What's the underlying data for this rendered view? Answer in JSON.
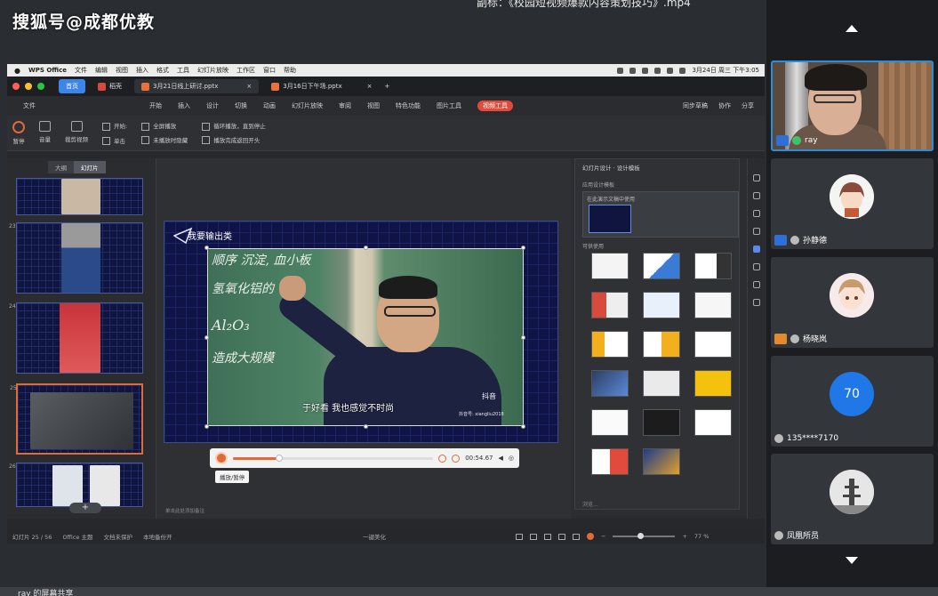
{
  "watermark": "搜狐号@成都优教",
  "window_title": "副标：《校园短视频爆款内容策划技巧》.mp4",
  "mac_menubar": {
    "app": "WPS Office",
    "items": [
      "文件",
      "编辑",
      "视图",
      "插入",
      "格式",
      "工具",
      "幻灯片放映",
      "工作区",
      "窗口",
      "帮助"
    ],
    "clock": "3月24日 周三 下午3:05"
  },
  "tabs": [
    {
      "label": "首页"
    },
    {
      "label": "稻壳"
    },
    {
      "label": "3月21日线上研讨.pptx"
    },
    {
      "label": "3月16日下午场.pptx"
    }
  ],
  "ribbon_tabs": [
    "文件",
    "开始",
    "插入",
    "设计",
    "切换",
    "动画",
    "幻灯片放映",
    "审阅",
    "视图",
    "特色功能",
    "图片工具",
    "视频工具"
  ],
  "ribbon_right": [
    "同步草稿",
    "协作",
    "分享"
  ],
  "ribbon": {
    "play": "暂停",
    "volume": "音量",
    "clip": "裁剪视频",
    "start_label": "开始:",
    "start_value": "单击",
    "opt_fullscreen": "全屏播放",
    "opt_hide": "未播放时隐藏",
    "opt_loop": "循环播放，直到停止",
    "opt_rewind": "播放完成返回开头"
  },
  "thumbs": {
    "tab_outline": "大纲",
    "tab_slides": "幻灯片",
    "numbers": [
      "23",
      "24",
      "25",
      "26"
    ],
    "add": "+"
  },
  "slide": {
    "title": "我要输出类",
    "chalk_lines": [
      "顺序 沉淀, 血小板",
      "氢氧化铝的",
      "Al₂O₃",
      "造成大规模"
    ],
    "subtitle": "于好看 我也感觉不时尚",
    "brand": "抖音",
    "brand_id": "抖音号: xiangliu2018",
    "time": "00:54.67",
    "tooltip": "播放/暂停",
    "notes_placeholder": "单击此处添加备注"
  },
  "video_progress": 0.23,
  "design_pane": {
    "title": "幻灯片设计 · 设计模板",
    "applied_label": "应用设计模板",
    "current_label": "在此演示文稿中使用",
    "available_label": "可供使用",
    "footer": "浏览..."
  },
  "status": {
    "slide": "幻灯片 25 / 56",
    "theme": "Office 主题",
    "protect": "文档未保护",
    "backup": "本地备份开",
    "beautify": "一键美化",
    "zoom": "77 %"
  },
  "bottom_strip": "ray 的屏幕共享",
  "participants": [
    {
      "name": "ray",
      "type": "video"
    },
    {
      "name": "孙静德",
      "type": "avatar"
    },
    {
      "name": "杨晓岚",
      "type": "avatar"
    },
    {
      "name": "135****7170",
      "type": "number",
      "initial": "70"
    },
    {
      "name": "凤凰所员",
      "type": "avatar"
    }
  ],
  "colors": {
    "accent": "#e06b35",
    "tile_border": "#2a8fd8",
    "avatar_blue": "#1f77e8"
  }
}
